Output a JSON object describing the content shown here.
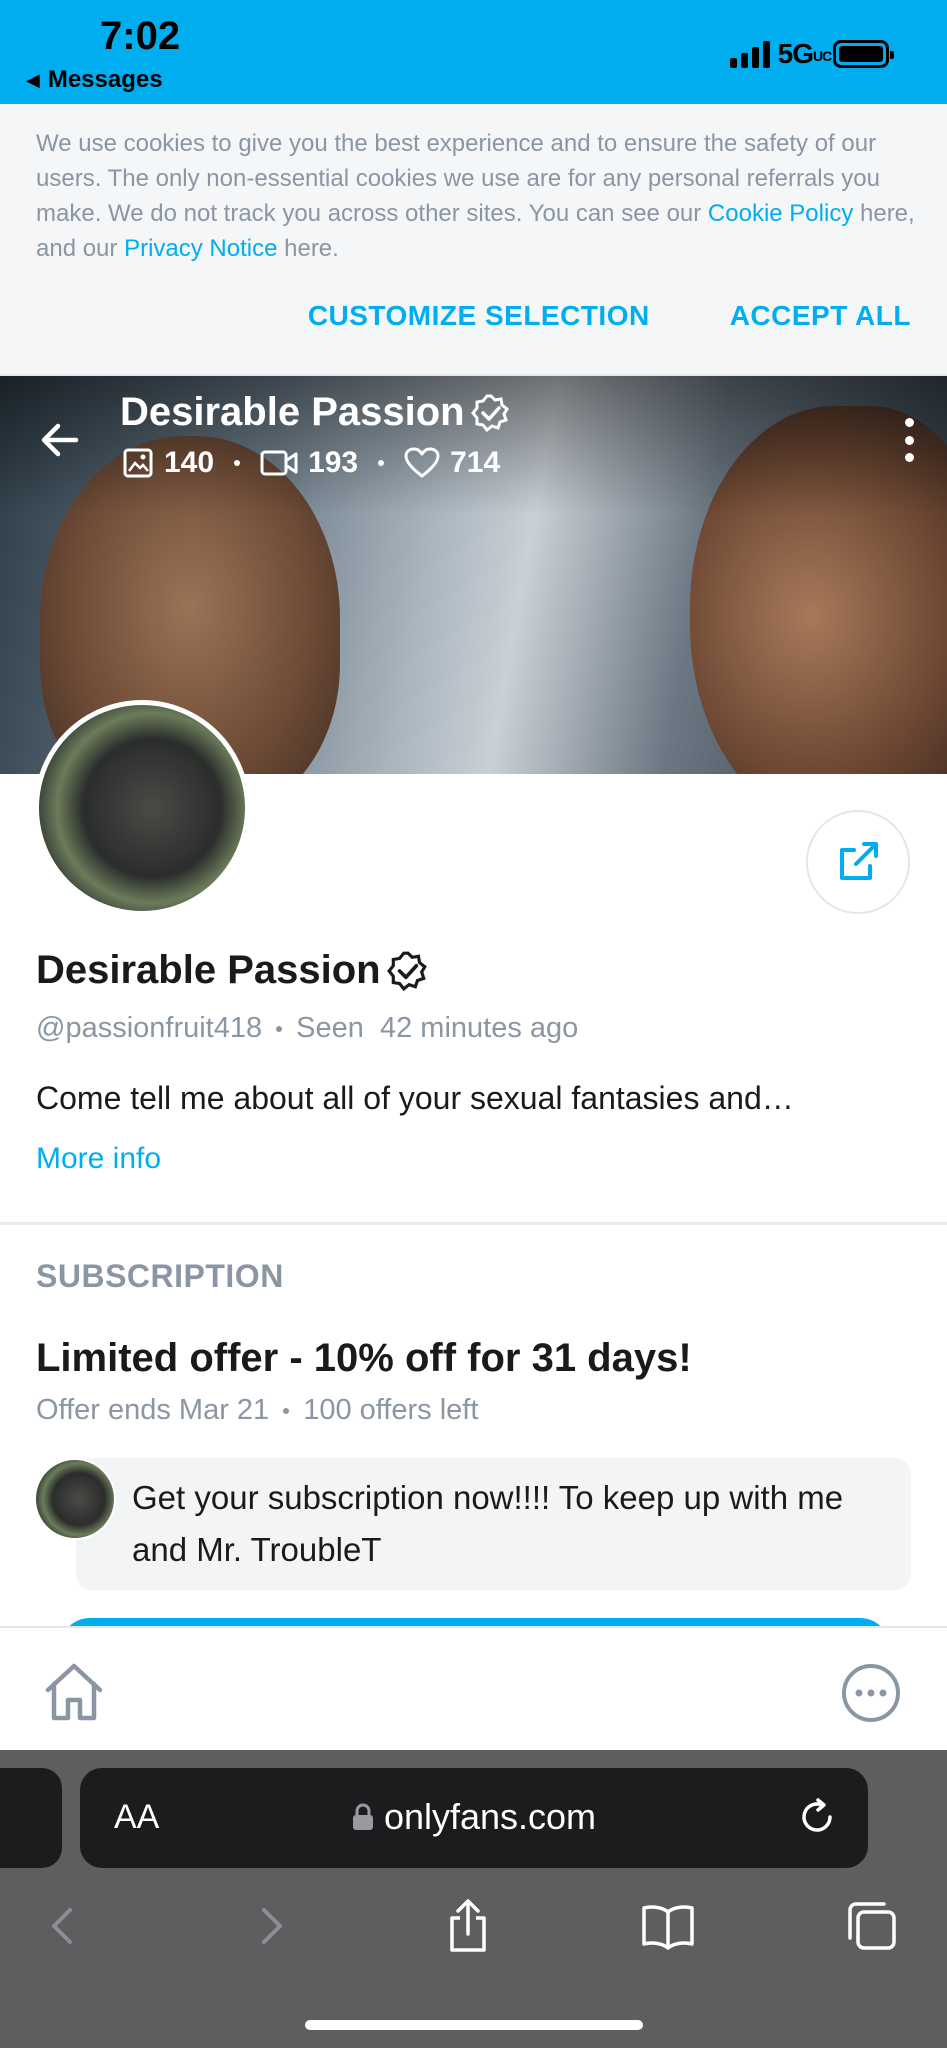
{
  "status_bar": {
    "time": "7:02",
    "back_app": "Messages",
    "network": "5G",
    "network_suffix": "UC"
  },
  "cookie_banner": {
    "text_part1": "We use cookies to give you the best experience and to ensure the safety of our users. The only non-essential cookies we use are for any personal referrals you make. We do not track you across other sites. You can see our ",
    "cookie_policy_link": "Cookie Policy",
    "text_part2": " here, and our ",
    "privacy_link": "Privacy Notice",
    "text_part3": " here.",
    "customize_label": "CUSTOMIZE SELECTION",
    "accept_label": "ACCEPT ALL"
  },
  "cover": {
    "title": "Desirable Passion",
    "photos_count": "140",
    "videos_count": "193",
    "likes_count": "714"
  },
  "profile": {
    "name": "Desirable Passion",
    "handle": "@passionfruit418",
    "last_seen": "Seen  42 minutes ago",
    "bio": "Come tell me about all of your sexual fantasies and…",
    "more_info_label": "More info"
  },
  "subscription": {
    "section_title": "SUBSCRIPTION",
    "offer_title": "Limited offer - 10% off for 31 days!",
    "offer_ends": "Offer ends Mar 21",
    "offers_left": "100 offers left",
    "message": "Get your subscription now!!!! To keep up with me and Mr. TroubleT"
  },
  "browser": {
    "aa_label": "AA",
    "url": "onlyfans.com"
  },
  "colors": {
    "accent": "#00aeef",
    "muted": "#8a96a3",
    "safari_bg": "#5e5e60"
  }
}
